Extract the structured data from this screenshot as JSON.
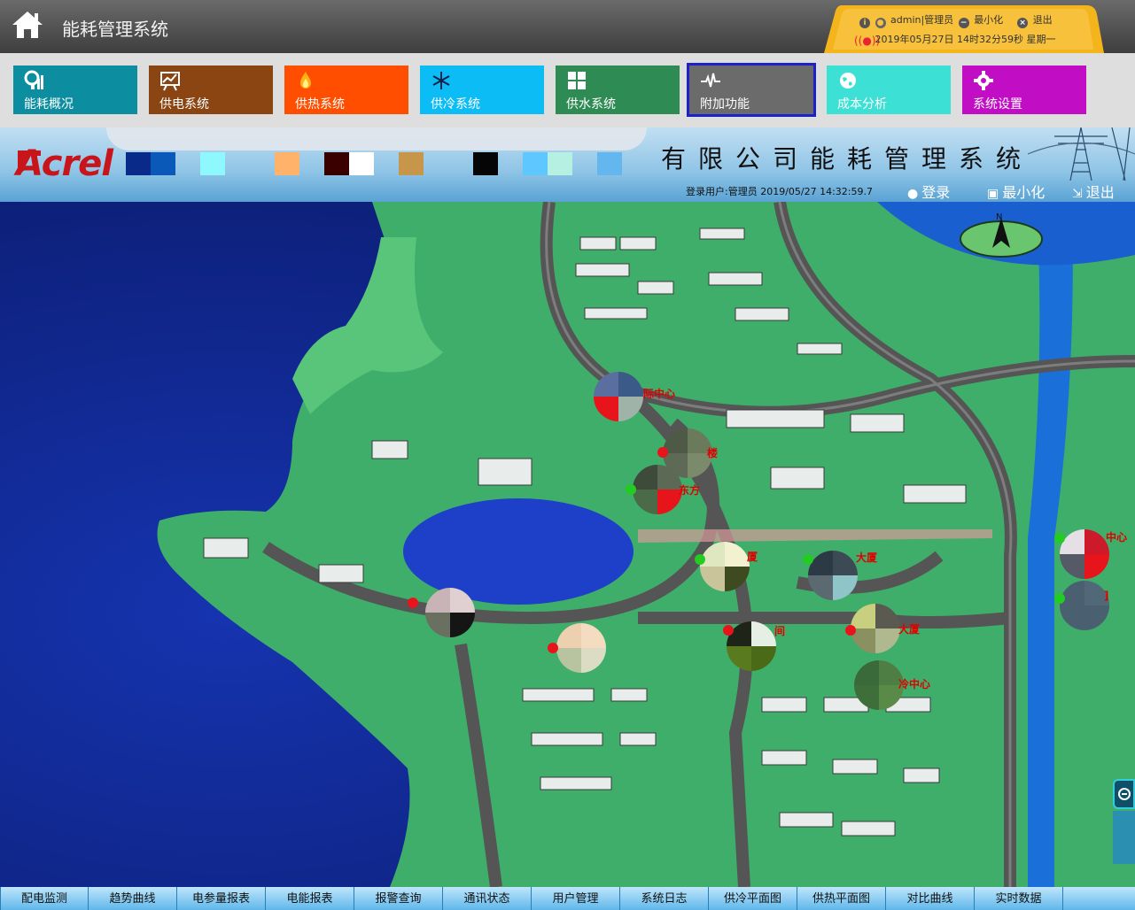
{
  "app": {
    "title": "能耗管理系统"
  },
  "userpanel": {
    "user": "admin|管理员",
    "minimize": "最小化",
    "exit": "退出",
    "datetime": "2019年05月27日 14时32分59秒 星期一",
    "accent": "#f4b51c"
  },
  "modules": [
    {
      "label": "能耗概况",
      "icon": "gauge-chart-icon",
      "color": "#0c8ea0"
    },
    {
      "label": "供电系统",
      "icon": "trend-board-icon",
      "color": "#8a4512"
    },
    {
      "label": "供热系统",
      "icon": "flame-icon",
      "color": "#ff4e00"
    },
    {
      "label": "供冷系统",
      "icon": "snowflake-icon",
      "color": "#0bbcf5"
    },
    {
      "label": "供水系统",
      "icon": "grid-icon",
      "color": "#2e8b53"
    },
    {
      "label": "附加功能",
      "icon": "pulse-icon",
      "color": "#6b6b6b"
    },
    {
      "label": "成本分析",
      "icon": "globe-icon",
      "color": "#3de0d5"
    },
    {
      "label": "系统设置",
      "icon": "gear-icon",
      "color": "#c10ec4"
    }
  ],
  "banner": {
    "logo": "Acrel",
    "system_title": "有限公司能耗管理系统",
    "login_info": "登录用户:管理员 2019/05/27 14:32:59.7",
    "login_btn": "登录",
    "minimize_btn": "最小化",
    "exit_btn": "退出",
    "swatch_colors": [
      "#0a2a8a",
      "#0a58b8",
      "#8ff8ff",
      "#ffb36a",
      "#3a0000",
      "#ffffff",
      "#c8964a",
      "#050505",
      "#5fc7ff",
      "#b6f0e2",
      "#64b6ee"
    ]
  },
  "map": {
    "labels": [
      "际中心",
      "楼",
      "东方",
      "厦",
      "大厦",
      "中心",
      "]",
      "间",
      "大厦",
      "冷中心"
    ]
  },
  "bottom_nav": [
    "配电监测",
    "趋势曲线",
    "电参量报表",
    "电能报表",
    "报警查询",
    "通讯状态",
    "用户管理",
    "系统日志",
    "供冷平面图",
    "供热平面图",
    "对比曲线",
    "实时数据"
  ]
}
